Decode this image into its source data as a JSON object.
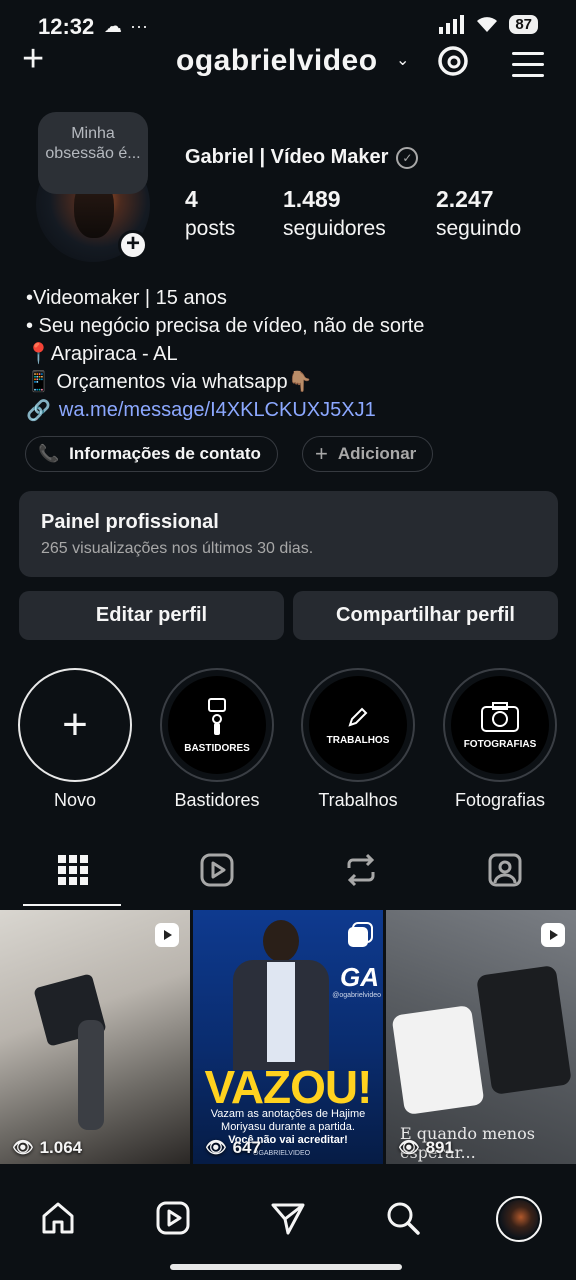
{
  "status": {
    "time": "12:32",
    "extra": "···",
    "battery": "87"
  },
  "header": {
    "username": "ogabrielvideo"
  },
  "profile": {
    "note": "Minha obsessão é...",
    "display_name": "Gabriel | Vídeo Maker",
    "stats": [
      {
        "value": "4",
        "label": "posts"
      },
      {
        "value": "1.489",
        "label": "seguidores"
      },
      {
        "value": "2.247",
        "label": "seguindo"
      }
    ],
    "bio": [
      "•Videomaker | 15 anos",
      "• Seu negócio precisa de vídeo, não de sorte",
      "📍Arapiraca - AL",
      "📱 Orçamentos via whatsapp👇🏽"
    ],
    "link": "wa.me/message/I4XKLCKUXJ5XJ1"
  },
  "chips": {
    "contact": "Informações de contato",
    "add": "Adicionar"
  },
  "panel": {
    "title": "Painel profissional",
    "subtitle": "265 visualizações nos últimos 30 dias."
  },
  "buttons": {
    "edit": "Editar perfil",
    "share": "Compartilhar perfil"
  },
  "highlights": [
    {
      "label": "Novo",
      "inner": "+"
    },
    {
      "label": "Bastidores",
      "inner": "BASTIDORES"
    },
    {
      "label": "Trabalhos",
      "inner": "TRABALHOS"
    },
    {
      "label": "Fotografias",
      "inner": "FOTOGRAFIAS"
    }
  ],
  "posts": [
    {
      "views": "1.064"
    },
    {
      "views": "647",
      "headline": "VAZOU!",
      "caption": "Vazam as anotações de Hajime Moriyasu durante a partida.",
      "cta": "Você não vai acreditar!",
      "brand": "GA",
      "brand_handle": "@ogabrielvideo",
      "footer": "OGABRIELVIDEO"
    },
    {
      "views": "891",
      "overlay": "E quando menos esperar..."
    }
  ],
  "colors": {
    "background": "#0c1014",
    "surface": "#262a30",
    "link": "#8ca8ff"
  }
}
